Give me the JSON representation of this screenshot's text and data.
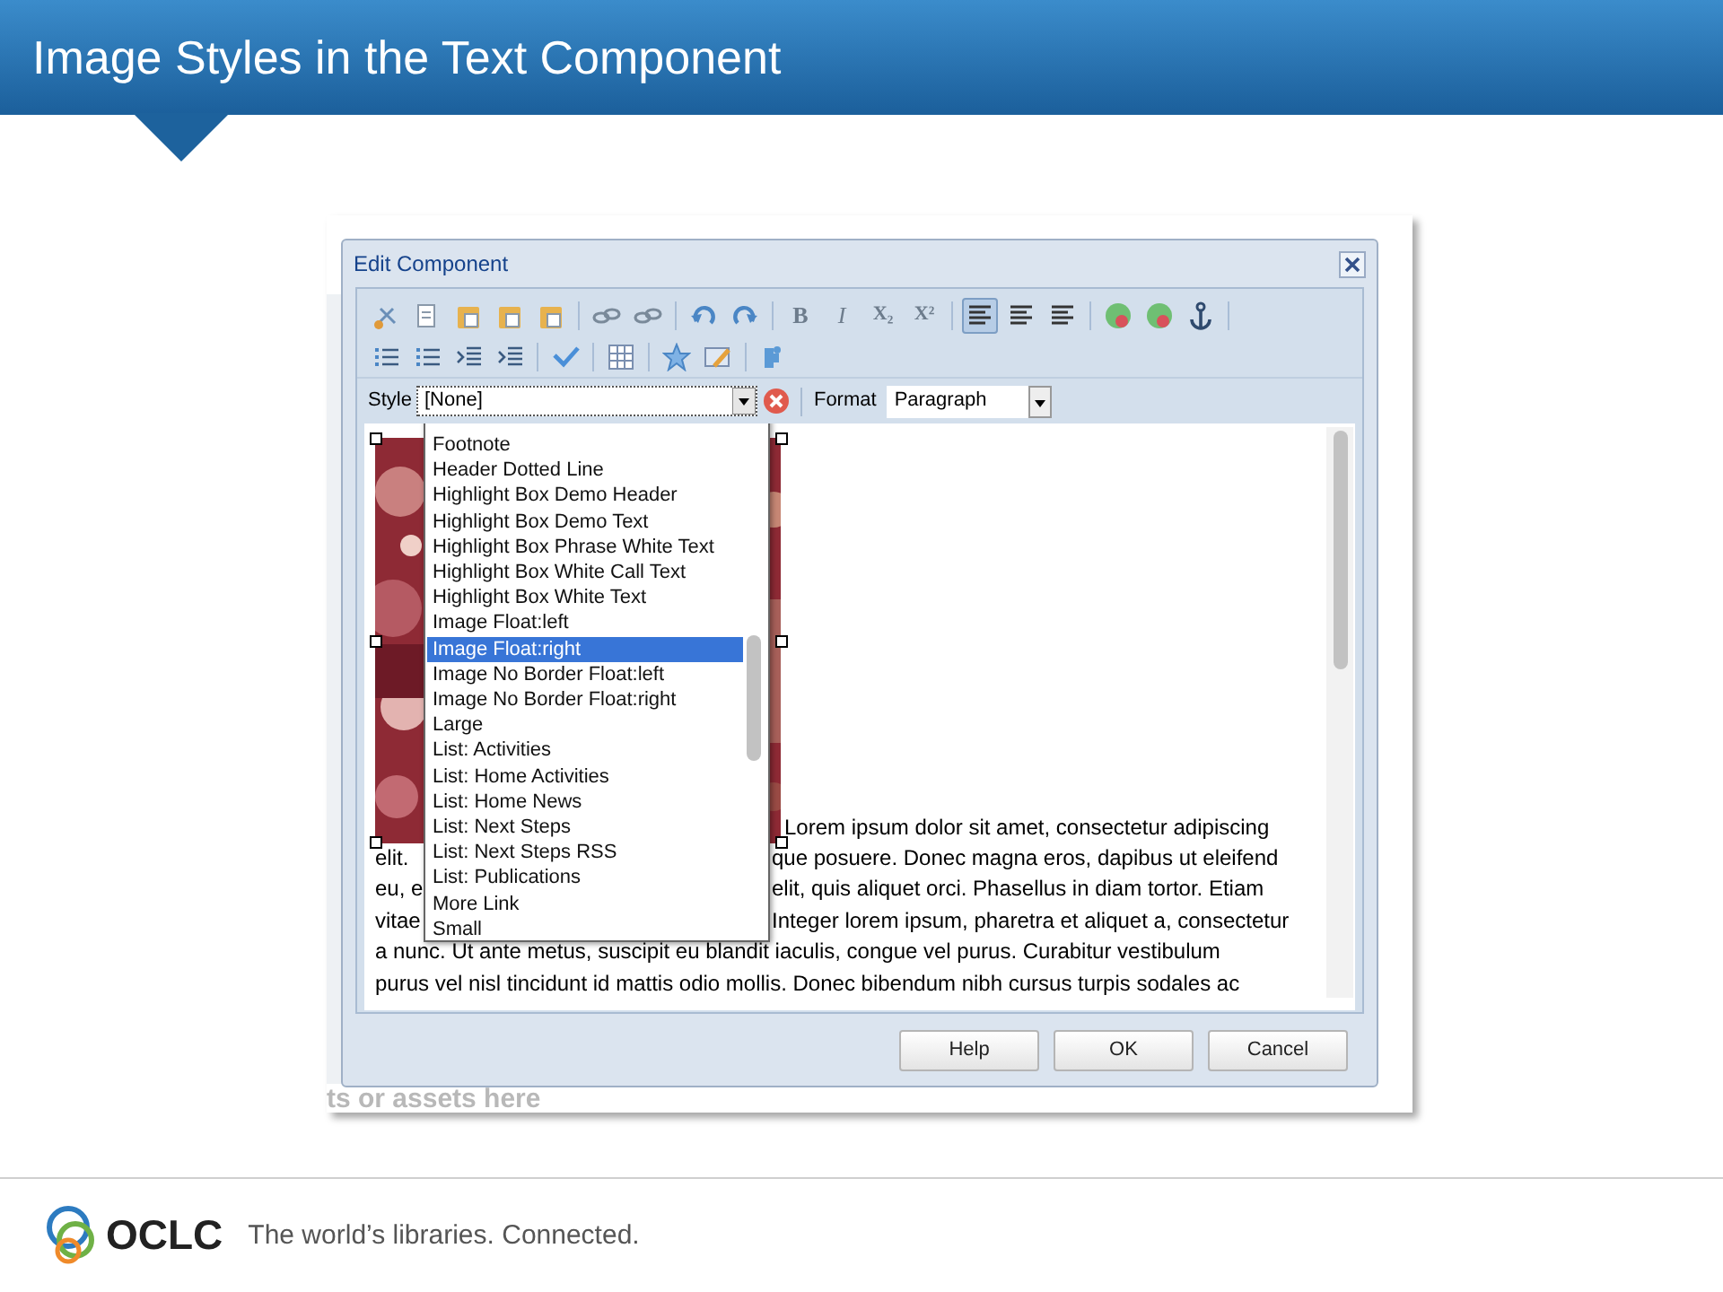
{
  "slide_title": "Image Styles in the Text Component",
  "dialog": {
    "title": "Edit Component",
    "toolbar_rows": [
      [
        {
          "kind": "cut"
        },
        {
          "kind": "copy"
        },
        {
          "kind": "paste"
        },
        {
          "kind": "paste"
        },
        {
          "kind": "paste"
        },
        {
          "kind": "sep"
        },
        {
          "kind": "link"
        },
        {
          "kind": "link"
        },
        {
          "kind": "sep"
        },
        {
          "kind": "undo"
        },
        {
          "kind": "redo"
        },
        {
          "kind": "sep"
        },
        {
          "kind": "text",
          "label": "B",
          "selected": false
        },
        {
          "kind": "text",
          "label": "I",
          "selected": false
        },
        {
          "kind": "text",
          "label": "X₂",
          "selected": false
        },
        {
          "kind": "text",
          "label": "X²",
          "selected": false
        },
        {
          "kind": "sep"
        },
        {
          "kind": "align",
          "selected": true
        },
        {
          "kind": "align",
          "selected": false
        },
        {
          "kind": "align",
          "selected": false
        },
        {
          "kind": "sep"
        },
        {
          "kind": "globe"
        },
        {
          "kind": "globe"
        },
        {
          "kind": "anchor"
        },
        {
          "kind": "sep"
        }
      ],
      [
        {
          "kind": "list"
        },
        {
          "kind": "list"
        },
        {
          "kind": "indent"
        },
        {
          "kind": "indent"
        },
        {
          "kind": "sep"
        },
        {
          "kind": "check"
        },
        {
          "kind": "sep"
        },
        {
          "kind": "table"
        },
        {
          "kind": "sep"
        },
        {
          "kind": "star"
        },
        {
          "kind": "edit"
        },
        {
          "kind": "sep"
        },
        {
          "kind": "puzzle"
        }
      ]
    ],
    "style_label": "Style",
    "style_value": "[None]",
    "format_label": "Format",
    "format_value": "Paragraph",
    "style_options": [
      {
        "label": "Footnote",
        "selected": false
      },
      {
        "label": "Header Dotted Line",
        "selected": false
      },
      {
        "label": "Highlight Box Demo Header",
        "selected": false
      },
      {
        "label": "Highlight Box Demo Text",
        "selected": false
      },
      {
        "label": "Highlight Box Phrase White Text",
        "selected": false
      },
      {
        "label": "Highlight Box White Call Text",
        "selected": false
      },
      {
        "label": "Highlight Box White Text",
        "selected": false
      },
      {
        "label": "Image Float:left",
        "selected": false
      },
      {
        "label": "Image Float:right",
        "selected": true
      },
      {
        "label": "Image No Border Float:left",
        "selected": false
      },
      {
        "label": "Image No Border Float:right",
        "selected": false
      },
      {
        "label": "Large",
        "selected": false
      },
      {
        "label": "List: Activities",
        "selected": false
      },
      {
        "label": "List: Home Activities",
        "selected": false
      },
      {
        "label": "List: Home News",
        "selected": false
      },
      {
        "label": "List: Next Steps",
        "selected": false
      },
      {
        "label": "List: Next Steps RSS",
        "selected": false
      },
      {
        "label": "List: Publications",
        "selected": false
      },
      {
        "label": "More Link",
        "selected": false
      },
      {
        "label": "Small",
        "selected": false
      }
    ],
    "first_line": "Lorem ipsum dolor sit amet, consectetur adipiscing",
    "lines": [
      {
        "left": "elit.",
        "right": "que posuere. Donec magna eros, dapibus ut eleifend"
      },
      {
        "left": "eu, e",
        "right": "elit, quis aliquet orci. Phasellus in diam tortor. Etiam"
      },
      {
        "left": "vitae",
        "right": "Integer lorem ipsum, pharetra et aliquet a, consectetur"
      },
      {
        "left": "a nunc. Ut ante metus, suscipit eu blandit iaculis, congue vel purus. Curabitur vestibulum"
      },
      {
        "left": "purus vel nisl tincidunt id mattis odio mollis. Donec bibendum nibh cursus turpis sodales ac"
      }
    ],
    "buttons": [
      "Help",
      "OK",
      "Cancel"
    ]
  },
  "background_text": "ts or assets here",
  "footer": {
    "brand": "OCLC",
    "tagline": "The world’s libraries. Connected."
  }
}
